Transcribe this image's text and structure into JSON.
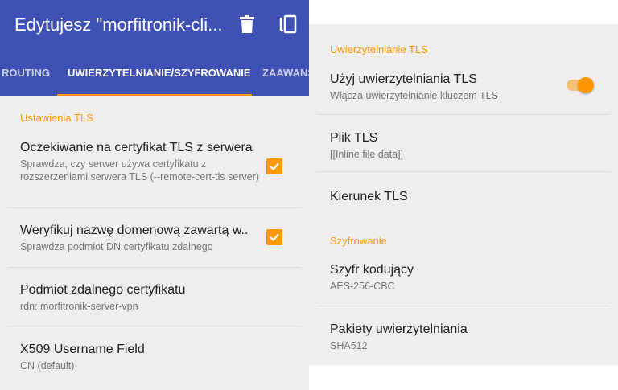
{
  "appbar": {
    "title": "Edytujesz \"morfitronik-cli...",
    "icons": [
      "delete-icon",
      "copy-icon"
    ]
  },
  "tabs": [
    {
      "label": "ROUTING",
      "active": false
    },
    {
      "label": "UWIERZYTELNIANIE/SZYFROWANIE",
      "active": true
    },
    {
      "label": "ZAAWANS",
      "active": false
    }
  ],
  "left": {
    "section": "Ustawienia TLS",
    "items": [
      {
        "title": "Oczekiwanie na certyfikat TLS z serwera",
        "subtitle": "Sprawdza, czy serwer używa certyfikatu z rozszerzeniami serwera TLS (--remote-cert-tls server)",
        "checked": true
      },
      {
        "title": "Weryfikuj nazwę domenową zawartą w..",
        "subtitle": "Sprawdza podmiot DN certyfikatu zdalnego",
        "checked": true
      },
      {
        "title": "Podmiot zdalnego certyfikatu",
        "subtitle": "rdn: morfitronik-server-vpn"
      },
      {
        "title": "X509 Username Field",
        "subtitle": "CN (default)"
      }
    ]
  },
  "right": {
    "section_tls": "Uwierzytelnianie TLS",
    "tls_items": [
      {
        "title": "Użyj uwierzytelniania TLS",
        "subtitle": "Włącza uwierzytelnianie kluczem TLS",
        "toggle_on": true
      },
      {
        "title": "Plik TLS",
        "subtitle": "[[Inline file data]]"
      },
      {
        "title": "Kierunek TLS",
        "subtitle": ""
      }
    ],
    "section_cipher": "Szyfrowanie",
    "cipher_items": [
      {
        "title": "Szyfr kodujący",
        "subtitle": "AES-256-CBC"
      },
      {
        "title": "Pakiety uwierzytelniania",
        "subtitle": "SHA512"
      }
    ]
  },
  "colors": {
    "primary": "#3f51b5",
    "accent": "#ff9800",
    "background": "#eeeeee"
  }
}
